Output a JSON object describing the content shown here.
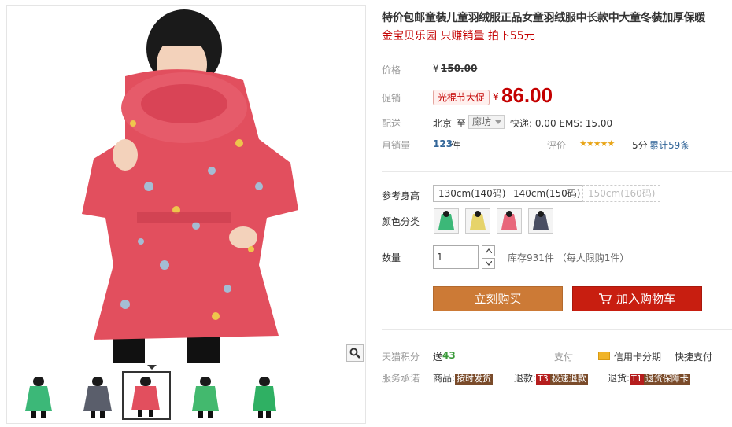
{
  "product": {
    "title": "特价包邮童装儿童羽绒服正品女童羽绒服中长款中大童冬装加厚保暖",
    "subtitle": "金宝贝乐园 只赚销量 拍下55元"
  },
  "price": {
    "label": "价格",
    "currency": "¥",
    "original": "150.00"
  },
  "promo": {
    "label": "促销",
    "badge": "光棍节大促",
    "currency": "¥",
    "price": "86.00"
  },
  "shipping": {
    "label": "配送",
    "from": "北京",
    "to_word": "至",
    "destination": "廊坊",
    "fees": "快递: 0.00 EMS: 15.00"
  },
  "sales": {
    "label": "月销量",
    "count": "123",
    "unit": "件",
    "rating_label": "评价",
    "stars": "★★★★★",
    "rating": 5,
    "score": "5分",
    "reviews": "累计59条"
  },
  "sizes": {
    "label": "参考身高",
    "options": [
      "130cm(140码)",
      "140cm(150码)",
      "150cm(160码)"
    ]
  },
  "colors": {
    "label": "颜色分类",
    "swatches": [
      "#3cb878",
      "#e6d36a",
      "#e8667a",
      "#4a4f63"
    ]
  },
  "quantity": {
    "label": "数量",
    "value": "1",
    "stock": "库存931件 （每人限购1件）"
  },
  "actions": {
    "buy": "立刻购买",
    "cart": "加入购物车"
  },
  "bottom": {
    "points_label": "天猫积分",
    "points_prefix": "送",
    "points": "43",
    "pay_label": "支付",
    "credit": "信用卡分期",
    "quick_pay": "快捷支付",
    "service_label": "服务承诺",
    "goods_prefix": "商品:",
    "goods_tag": "按时发货",
    "refund_prefix": "退款:",
    "refund_code": "T3",
    "refund_tag": "极速退款",
    "return_prefix": "退货:",
    "return_code": "T1",
    "return_tag": "退货保障卡"
  },
  "colors_theme": {
    "accent_red": "#c40000",
    "buy_orange": "#cc7a36",
    "cart_red": "#c81e10"
  }
}
